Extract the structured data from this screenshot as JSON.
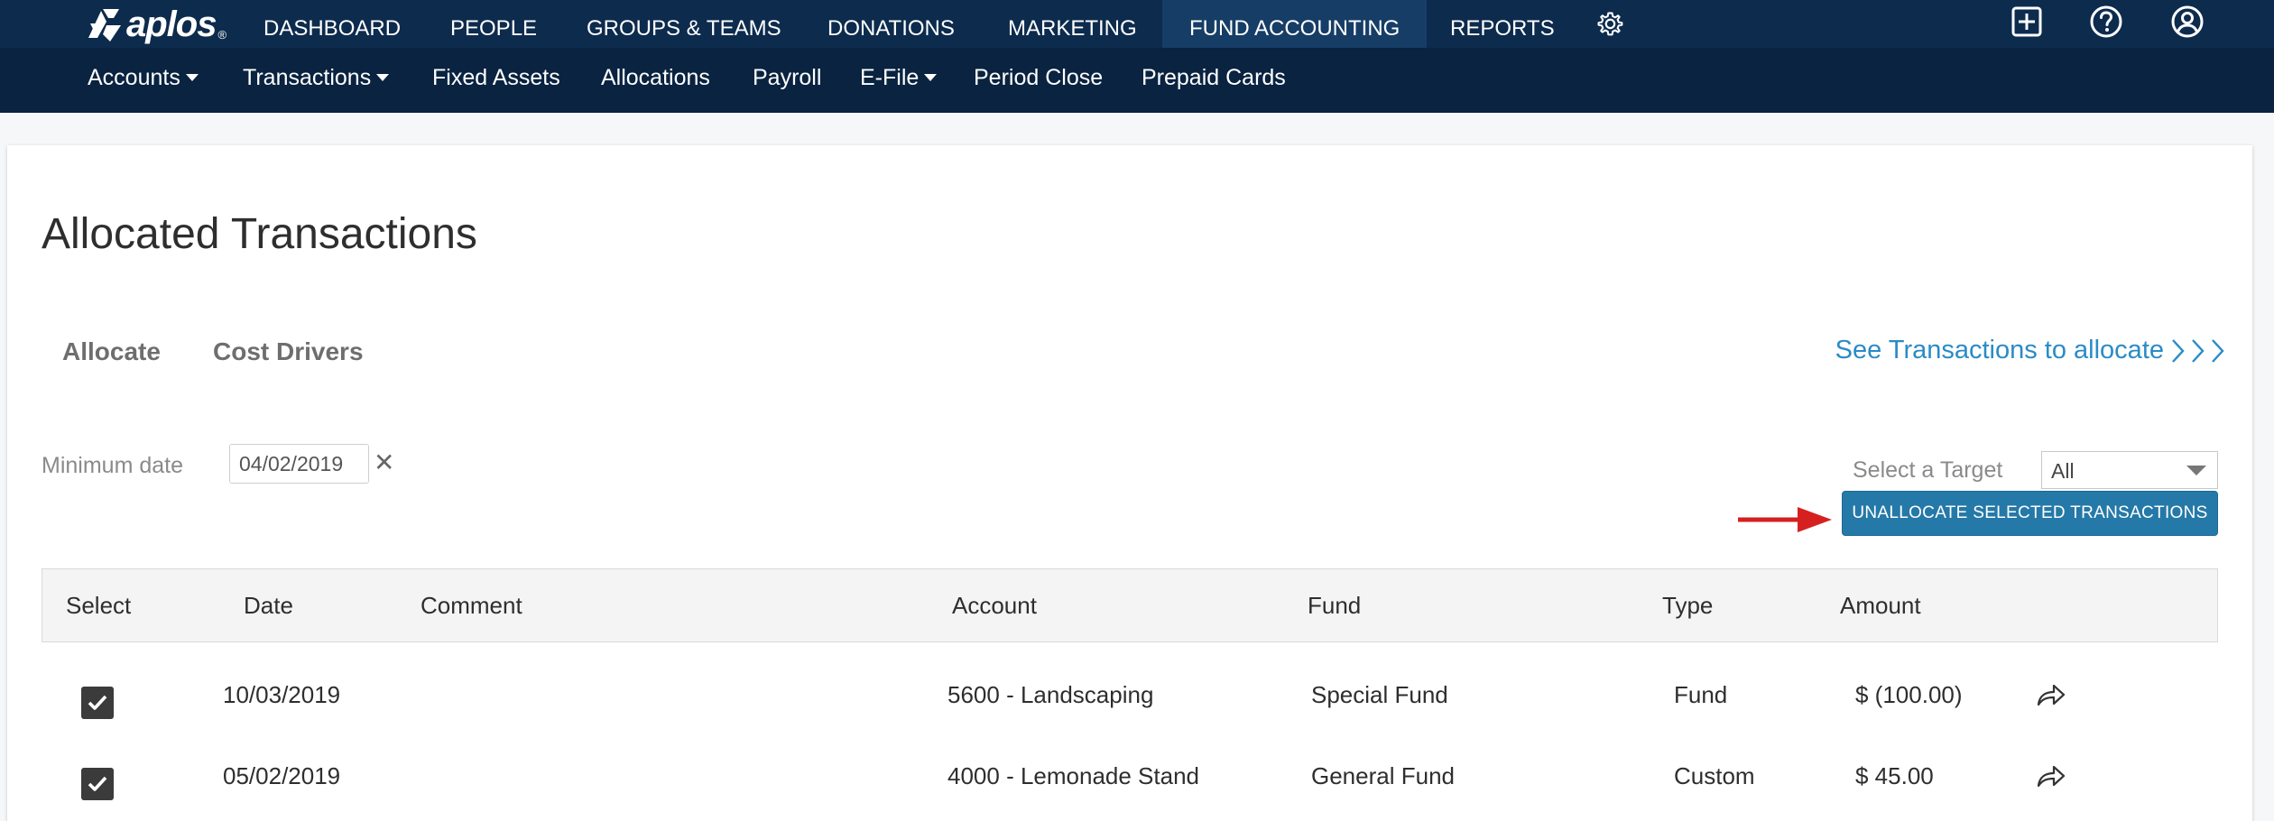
{
  "brand": {
    "name": "aplos",
    "reg": "®"
  },
  "topnav": {
    "items": [
      {
        "label": "DASHBOARD"
      },
      {
        "label": "PEOPLE"
      },
      {
        "label": "GROUPS & TEAMS"
      },
      {
        "label": "DONATIONS"
      },
      {
        "label": "MARKETING"
      },
      {
        "label": "FUND ACCOUNTING",
        "active": true
      },
      {
        "label": "REPORTS"
      }
    ],
    "icons": [
      "gear-icon",
      "add-icon",
      "help-icon",
      "account-icon"
    ]
  },
  "subnav": {
    "items": [
      {
        "label": "Accounts",
        "dropdown": true
      },
      {
        "label": "Transactions",
        "dropdown": true
      },
      {
        "label": "Fixed Assets"
      },
      {
        "label": "Allocations"
      },
      {
        "label": "Payroll"
      },
      {
        "label": "E-File",
        "dropdown": true
      },
      {
        "label": "Period Close"
      },
      {
        "label": "Prepaid Cards"
      }
    ]
  },
  "page": {
    "title": "Allocated Transactions",
    "tabs": [
      {
        "label": "Allocate"
      },
      {
        "label": "Cost Drivers"
      }
    ],
    "see_link": "See Transactions to allocate",
    "filters": {
      "min_date_label": "Minimum date",
      "min_date_value": "04/02/2019",
      "clear_symbol": "✕",
      "target_label": "Select a Target",
      "target_value": "All"
    },
    "unallocate_button": "UNALLOCATE SELECTED TRANSACTIONS"
  },
  "table": {
    "headers": [
      "Select",
      "Date",
      "Comment",
      "Account",
      "Fund",
      "Type",
      "Amount"
    ],
    "rows": [
      {
        "checked": true,
        "date": "10/03/2019",
        "comment": "",
        "account": "5600 - Landscaping",
        "fund": "Special Fund",
        "type": "Fund",
        "amount": "$ (100.00)"
      },
      {
        "checked": true,
        "date": "05/02/2019",
        "comment": "",
        "account": "4000 - Lemonade Stand",
        "fund": "General Fund",
        "type": "Custom",
        "amount": "$ 45.00"
      }
    ]
  },
  "colors": {
    "topnav_bg": "#0d2b4d",
    "subnav_bg": "#092340",
    "accent": "#2579a8",
    "link": "#2a8bc7",
    "arrow": "#d62020"
  }
}
